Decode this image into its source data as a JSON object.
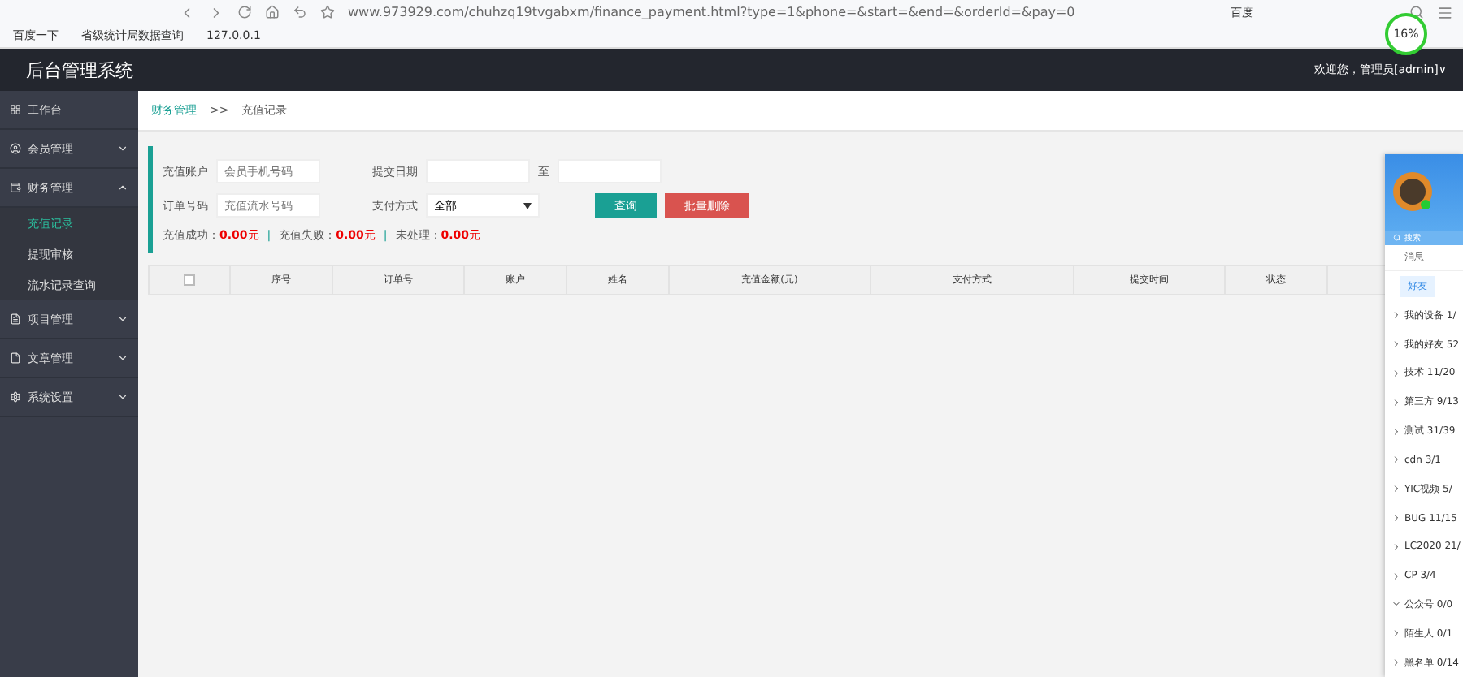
{
  "browser": {
    "url": "www.973929.com/chuhzq19tvgabxm/finance_payment.html?type=1&phone=&start=&end=&orderId=&pay=0",
    "bookmarks": [
      "百度一下",
      "省级统计局数据查询",
      "127.0.0.1"
    ],
    "search_engine": "百度",
    "speed_badge": "16%"
  },
  "header": {
    "title": "后台管理系统",
    "user": "欢迎您，管理员[admin]∨"
  },
  "sidebar": {
    "items": [
      {
        "label": "工作台",
        "has_children": false
      },
      {
        "label": "会员管理",
        "expanded": false,
        "has_children": true
      },
      {
        "label": "财务管理",
        "expanded": true,
        "has_children": true,
        "children": [
          {
            "label": "充值记录",
            "selected": true
          },
          {
            "label": "提现审核",
            "selected": false
          },
          {
            "label": "流水记录查询",
            "selected": false
          }
        ]
      },
      {
        "label": "项目管理",
        "expanded": false,
        "has_children": true
      },
      {
        "label": "文章管理",
        "expanded": false,
        "has_children": true
      },
      {
        "label": "系统设置",
        "expanded": false,
        "has_children": true
      }
    ]
  },
  "breadcrumb": [
    "财务管理",
    ">>",
    "充值记录"
  ],
  "filters": {
    "account_label": "充值账户",
    "account_placeholder": "会员手机号码",
    "date_label": "提交日期",
    "date_to": "至",
    "order_label": "订单号码",
    "order_placeholder": "充值流水号码",
    "pay_label": "支付方式",
    "pay_value": "全部",
    "search_button": "查询",
    "delete_button": "批量删除"
  },
  "summary_separator": "|",
  "summary": [
    {
      "label": "充值成功：",
      "value": "0.00",
      "unit": "元"
    },
    {
      "label": "充值失败：",
      "value": "0.00",
      "unit": "元"
    },
    {
      "label": "未处理：",
      "value": "0.00",
      "unit": "元"
    }
  ],
  "table": {
    "select_all_checked": false,
    "columns": [
      "序号",
      "订单号",
      "账户",
      "姓名",
      "充值金额(元)",
      "支付方式",
      "提交时间",
      "状态"
    ]
  },
  "qq_panel": {
    "search": "搜索",
    "tab": "消息",
    "subtab": "好友",
    "groups": [
      {
        "label": "我的设备 1/",
        "expanded": false
      },
      {
        "label": "我的好友 52",
        "expanded": false
      },
      {
        "label": "技术 11/20",
        "expanded": false
      },
      {
        "label": "第三方 9/13",
        "expanded": false
      },
      {
        "label": "测试 31/39",
        "expanded": false
      },
      {
        "label": "cdn 3/1",
        "expanded": false
      },
      {
        "label": "YIC视频 5/",
        "expanded": false
      },
      {
        "label": "BUG 11/15",
        "expanded": false
      },
      {
        "label": "LC2020 21/",
        "expanded": false
      },
      {
        "label": "CP 3/4",
        "expanded": false
      },
      {
        "label": "公众号 0/0",
        "expanded": true
      },
      {
        "label": "陌生人 0/1",
        "expanded": false
      },
      {
        "label": "黑名单 0/14",
        "expanded": false
      }
    ]
  }
}
